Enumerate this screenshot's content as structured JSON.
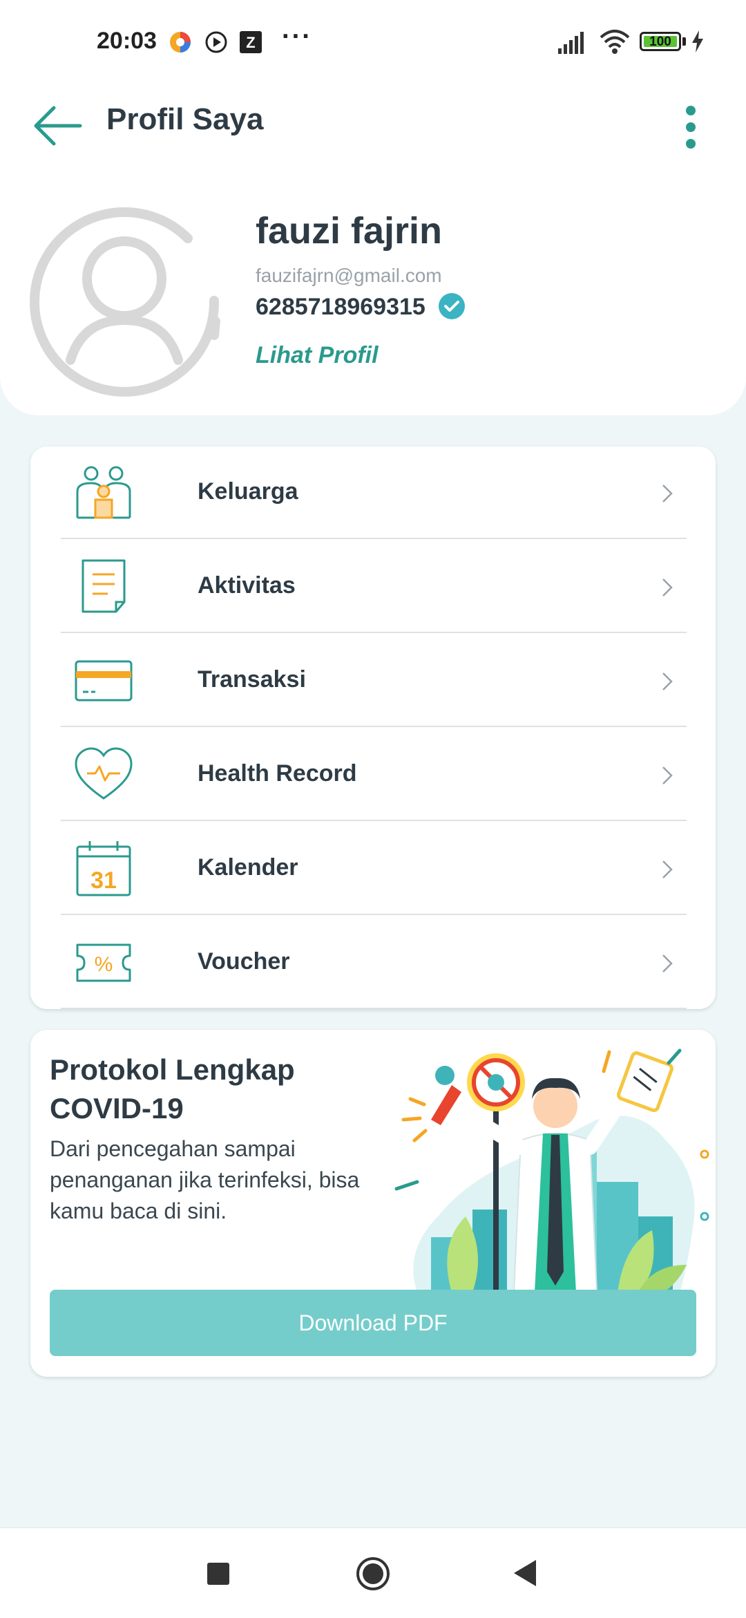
{
  "status_bar": {
    "time": "20:03",
    "battery_level": "100",
    "icons": [
      "app-icon-colorful",
      "play-circle-icon",
      "z-app-icon",
      "more-dots-icon",
      "signal-icon",
      "wifi-icon",
      "battery-icon",
      "charging-bolt-icon"
    ],
    "dots": "···"
  },
  "header": {
    "title": "Profil Saya",
    "back_icon": "arrow-left-icon",
    "menu_icon": "more-vertical-icon"
  },
  "profile": {
    "name": "fauzi fajrin",
    "email": "fauzifajrn@gmail.com",
    "phone": "6285718969315",
    "verified": true,
    "view_profile_label": "Lihat Profil"
  },
  "menu": {
    "items": [
      {
        "label": "Keluarga",
        "icon": "family-icon"
      },
      {
        "label": "Aktivitas",
        "icon": "activity-document-icon"
      },
      {
        "label": "Transaksi",
        "icon": "credit-card-icon"
      },
      {
        "label": "Health Record",
        "icon": "heart-pulse-icon"
      },
      {
        "label": "Kalender",
        "icon": "calendar-icon",
        "icon_text": "31"
      },
      {
        "label": "Voucher",
        "icon": "voucher-percent-icon",
        "icon_text": "%"
      }
    ]
  },
  "covid": {
    "title": "Protokol Lengkap COVID-19",
    "description": "Dari pencegahan sampai penanganan jika terinfeksi, bisa kamu baca di sini.",
    "button_label": "Download PDF"
  },
  "colors": {
    "teal": "#2A9A8E",
    "orange": "#F5A623",
    "button": "#74CDCB",
    "background": "#EEF6F8"
  }
}
